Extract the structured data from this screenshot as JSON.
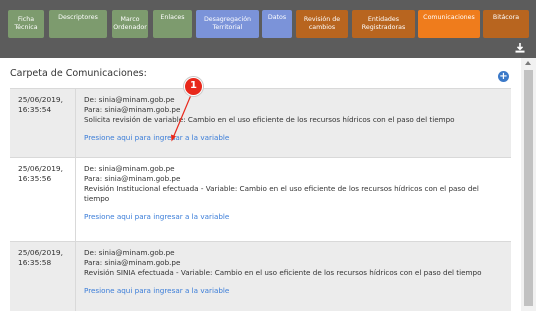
{
  "tabs": [
    {
      "label": "Ficha\nTécnica",
      "color": "green"
    },
    {
      "label": "Descriptores",
      "color": "green"
    },
    {
      "label": "Marco\nOrdenador",
      "color": "green"
    },
    {
      "label": "Enlaces",
      "color": "green"
    },
    {
      "label": "Desagregación\nTerritorial",
      "color": "blue"
    },
    {
      "label": "Datos",
      "color": "blue"
    },
    {
      "label": "Revisión de\ncambios",
      "color": "brown"
    },
    {
      "label": "Entidades\nRegistradoras",
      "color": "brown"
    },
    {
      "label": "Comunicaciones",
      "color": "orange"
    },
    {
      "label": "Bitácora",
      "color": "brown"
    }
  ],
  "icons": {
    "download": "download-icon",
    "add": "plus-circle-icon"
  },
  "panel": {
    "title": "Carpeta de Comunicaciones:"
  },
  "messages": [
    {
      "date": "25/06/2019,",
      "time": "16:35:54",
      "from": "De: sinia@minam.gob.pe",
      "to": "Para: sinia@minam.gob.pe",
      "body": "Solicita revisión de variable: Cambio en el uso eficiente de los recursos hídricos con el paso del tiempo",
      "link": "Presione aqui para ingresar a la variable"
    },
    {
      "date": "25/06/2019,",
      "time": "16:35:56",
      "from": "De: sinia@minam.gob.pe",
      "to": "Para: sinia@minam.gob.pe",
      "body": "Revisión Institucional efectuada - Variable: Cambio en el uso eficiente de los recursos hídricos con el paso del tiempo",
      "link": "Presione aqui para ingresar a la variable"
    },
    {
      "date": "25/06/2019,",
      "time": "16:35:58",
      "from": "De: sinia@minam.gob.pe",
      "to": "Para: sinia@minam.gob.pe",
      "body": "Revisión SINIA efectuada - Variable: Cambio en el uso eficiente de los recursos hídricos con el paso del tiempo",
      "link": "Presione aqui para ingresar a la variable"
    }
  ],
  "annotation": {
    "number": "1"
  },
  "colors": {
    "accent_orange": "#ef7c1c",
    "link_blue": "#3b7dd8",
    "badge_red": "#e8281b"
  }
}
